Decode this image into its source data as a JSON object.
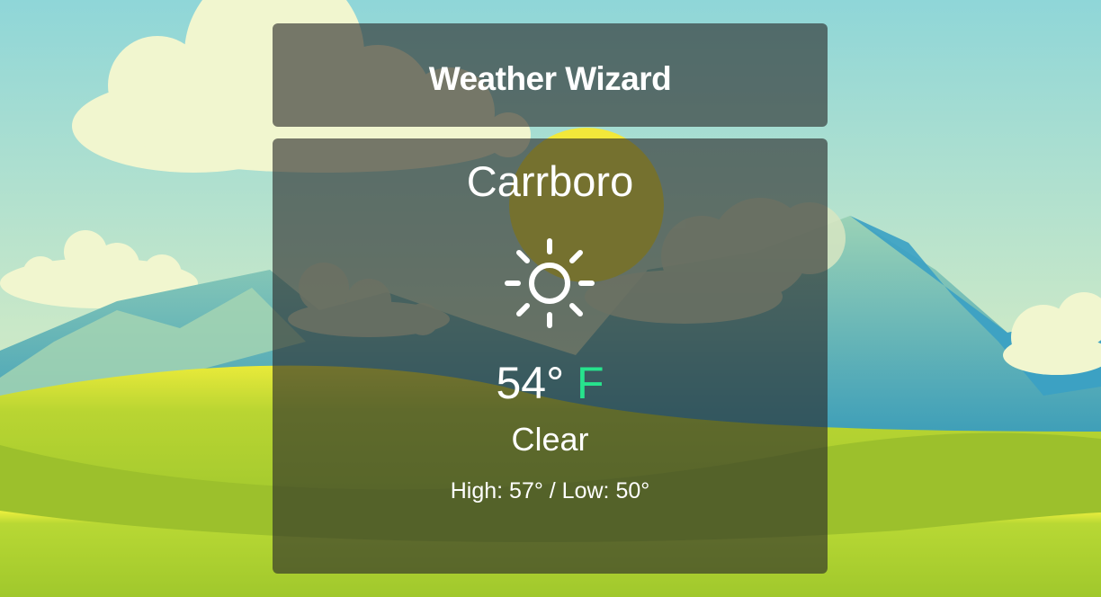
{
  "header": {
    "title": "Weather Wizard"
  },
  "weather": {
    "city": "Carrboro",
    "temperature": "54°",
    "unit": "F",
    "condition": "Clear",
    "high_low": "High: 57° / Low: 50°",
    "icon": "sun-icon"
  },
  "colors": {
    "unit_accent": "#27e38d",
    "card_overlay": "rgba(40,40,40,0.62)",
    "sky_top": "#8fd6d8",
    "sky_bottom": "#e9f1bd",
    "grass": "#a9cf2f",
    "sun": "#f2e83a",
    "mountain": "#3aa0b8"
  }
}
